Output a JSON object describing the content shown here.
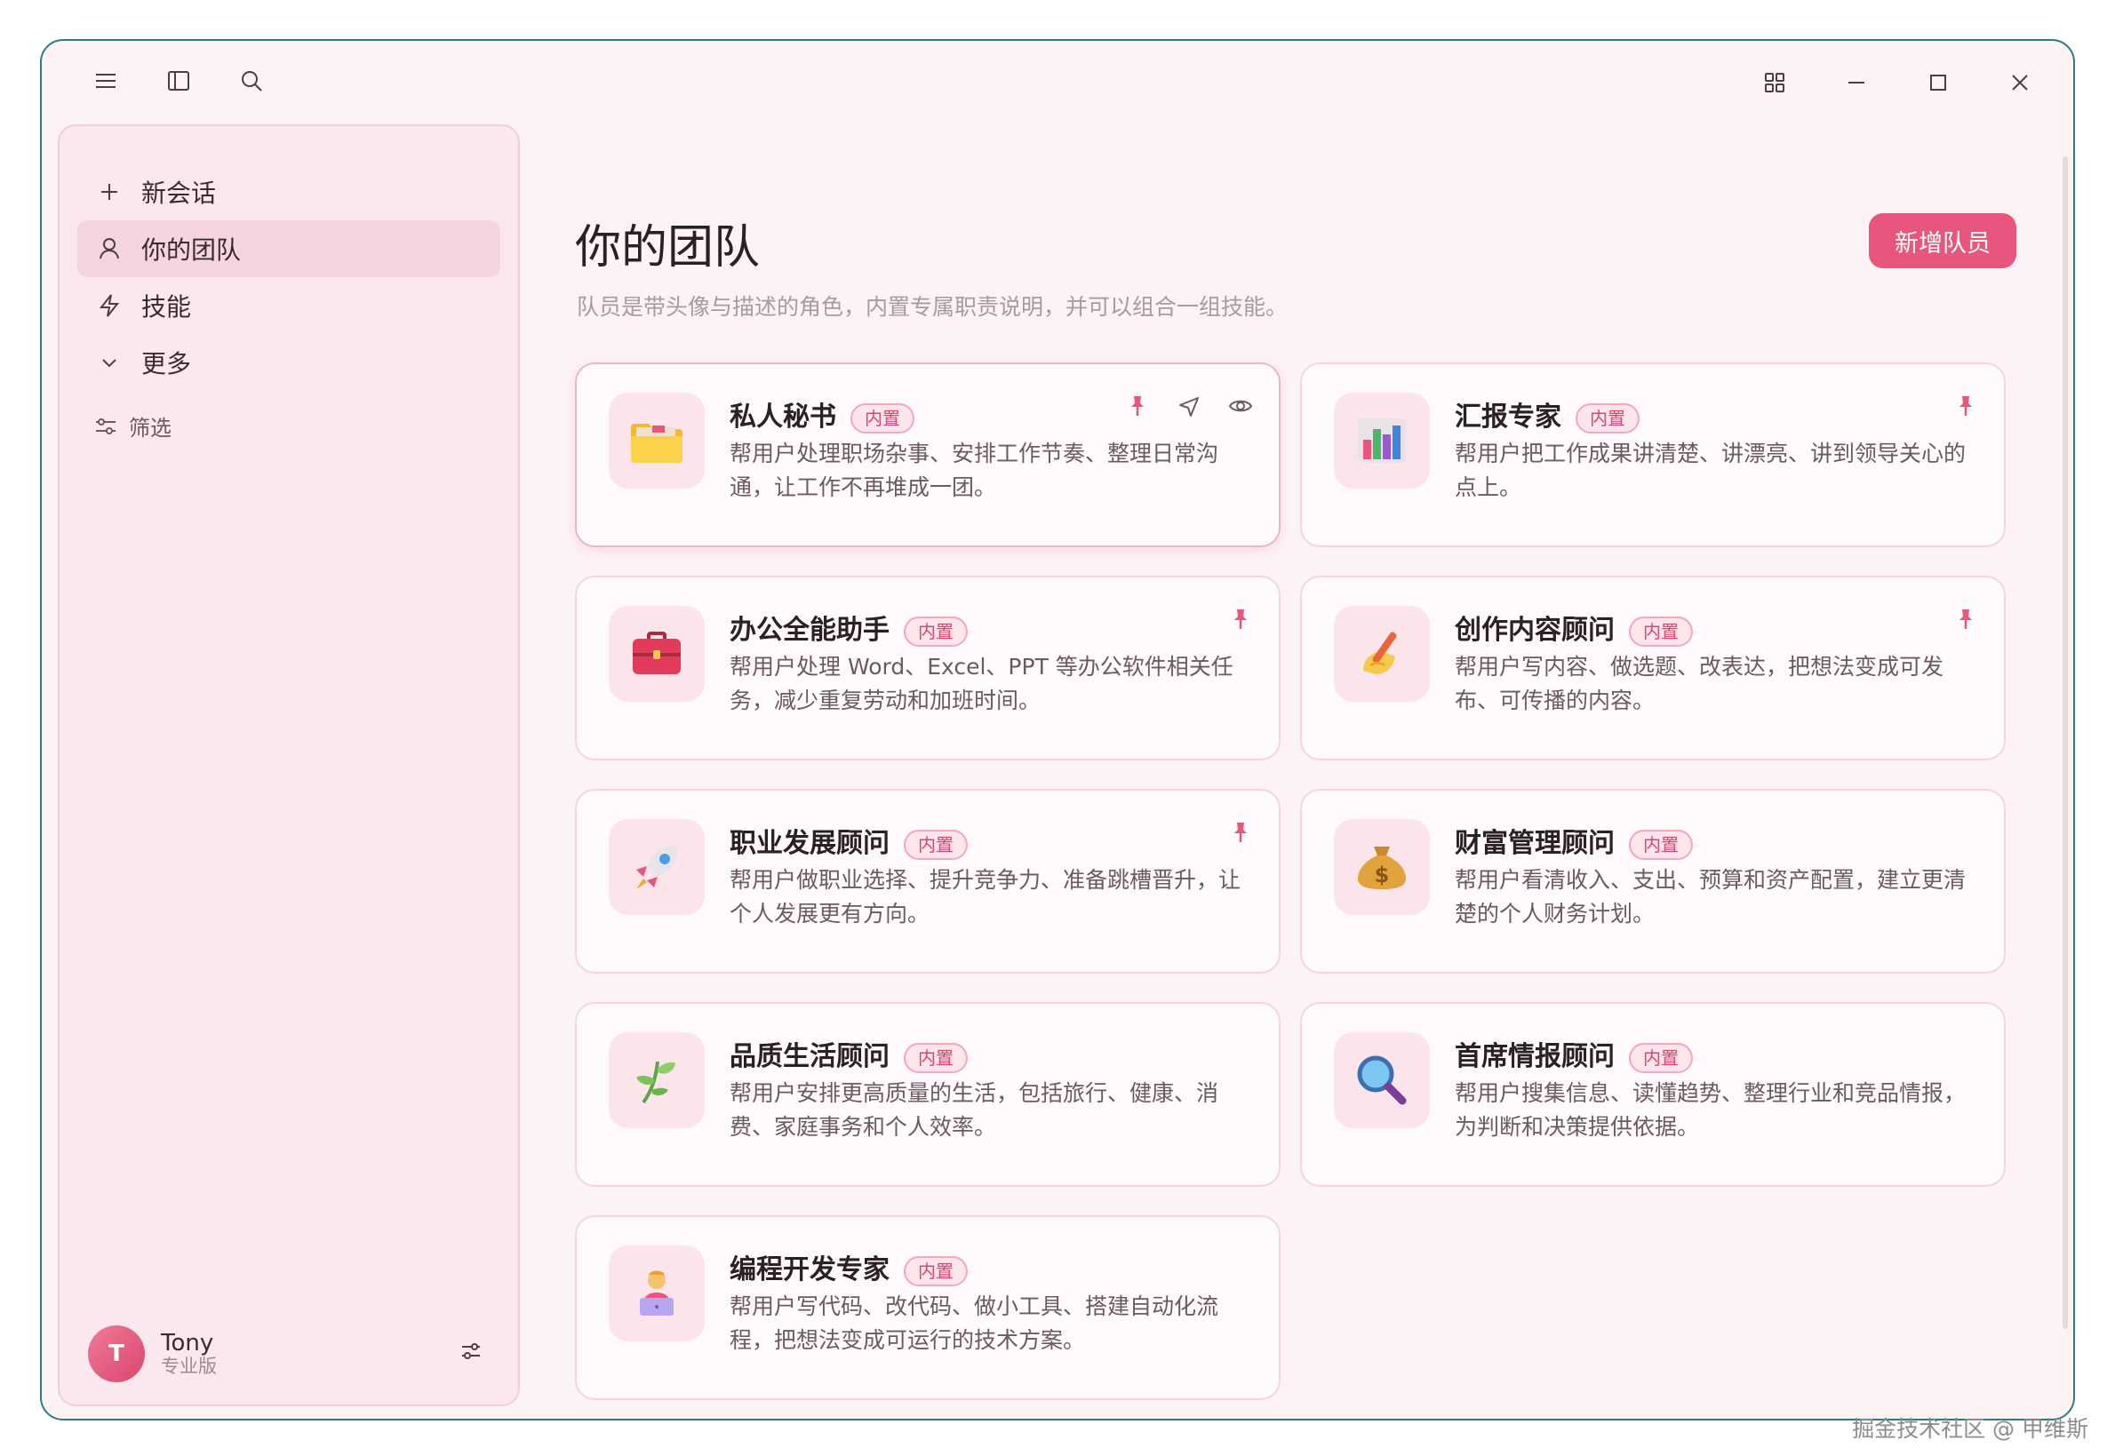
{
  "sidebar": {
    "items": [
      {
        "label": "新会话",
        "icon": "plus-icon"
      },
      {
        "label": "你的团队",
        "icon": "person-icon",
        "active": true
      },
      {
        "label": "技能",
        "icon": "lightning-icon"
      },
      {
        "label": "更多",
        "icon": "chevron-down-icon"
      }
    ],
    "filter_label": "筛选",
    "user": {
      "initial": "T",
      "name": "Tony",
      "plan": "专业版"
    }
  },
  "main": {
    "title": "你的团队",
    "subtitle": "队员是带头像与描述的角色，内置专属职责说明，并可以组合一组技能。",
    "add_button": "新增队员",
    "badge_label": "内置",
    "cards": [
      {
        "title": "私人秘书",
        "desc": "帮用户处理职场杂事、安排工作节奏、整理日常沟通，让工作不再堆成一团。",
        "icon": "folder-icon",
        "actions": [
          "pin",
          "send",
          "view"
        ]
      },
      {
        "title": "汇报专家",
        "desc": "帮用户把工作成果讲清楚、讲漂亮、讲到领导关心的点上。",
        "icon": "bar-chart-icon",
        "actions": [
          "pin"
        ]
      },
      {
        "title": "办公全能助手",
        "desc": "帮用户处理 Word、Excel、PPT 等办公软件相关任务，减少重复劳动和加班时间。",
        "icon": "briefcase-icon",
        "actions": [
          "pin"
        ]
      },
      {
        "title": "创作内容顾问",
        "desc": "帮用户写内容、做选题、改表达，把想法变成可发布、可传播的内容。",
        "icon": "writing-hand-icon",
        "actions": [
          "pin"
        ]
      },
      {
        "title": "职业发展顾问",
        "desc": "帮用户做职业选择、提升竞争力、准备跳槽晋升，让个人发展更有方向。",
        "icon": "rocket-icon",
        "actions": [
          "pin"
        ]
      },
      {
        "title": "财富管理顾问",
        "desc": "帮用户看清收入、支出、预算和资产配置，建立更清楚的个人财务计划。",
        "icon": "money-bag-icon",
        "actions": []
      },
      {
        "title": "品质生活顾问",
        "desc": "帮用户安排更高质量的生活，包括旅行、健康、消费、家庭事务和个人效率。",
        "icon": "herb-icon",
        "actions": []
      },
      {
        "title": "首席情报顾问",
        "desc": "帮用户搜集信息、读懂趋势、整理行业和竞品情报，为判断和决策提供依据。",
        "icon": "magnifier-icon",
        "actions": []
      },
      {
        "title": "编程开发专家",
        "desc": "帮用户写代码、改代码、做小工具、搭建自动化流程，把想法变成可运行的技术方案。",
        "icon": "developer-icon",
        "actions": []
      }
    ]
  },
  "watermark": "掘金技术社区 @ 甲维斯",
  "colors": {
    "accent": "#e8557d",
    "background": "#fdf2f4",
    "sidebar": "#fbe8ee"
  }
}
